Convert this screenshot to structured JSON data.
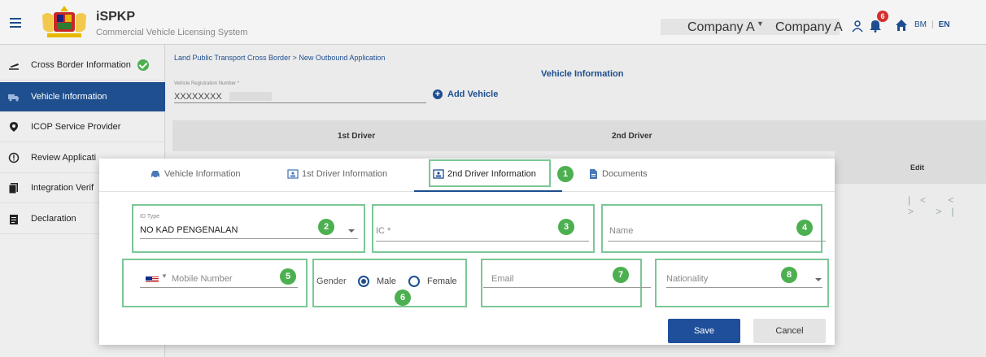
{
  "header": {
    "app_title": "iSPKP",
    "app_subtitle": "Commercial Vehicle Licensing System",
    "company_select": "Company A",
    "company_name": "Company A",
    "notification_count": "6",
    "lang_bm": "BM",
    "lang_en": "EN",
    "icons": [
      "menu-icon",
      "user-icon",
      "bell-icon",
      "home-icon"
    ]
  },
  "sidebar": {
    "items": [
      {
        "label": "Cross Border Information",
        "icon": "airplane-icon",
        "completed": true
      },
      {
        "label": "Vehicle Information",
        "icon": "truck-icon",
        "active": true
      },
      {
        "label": "ICOP Service Provider",
        "icon": "location-pin-icon"
      },
      {
        "label": "Review Applicati",
        "icon": "info-circle-icon"
      },
      {
        "label": "Integration Verif",
        "icon": "document-icon"
      },
      {
        "label": "Declaration",
        "icon": "clipboard-icon"
      }
    ]
  },
  "main": {
    "breadcrumb": "Land Public Transport Cross Border > New Outbound Application",
    "section_title": "Vehicle Information",
    "vehicle_reg_label": "Vehicle Registration Number *",
    "vehicle_reg_value": "XXXXXXXX",
    "add_vehicle": "Add Vehicle",
    "driver_1_header": "1st Driver",
    "driver_2_header": "2nd Driver",
    "edit_header": "Edit",
    "pager": "|< < > >|"
  },
  "modal": {
    "tabs": [
      {
        "label": "Vehicle Information",
        "icon": "car-icon"
      },
      {
        "label": "1st Driver Information",
        "icon": "id-card-icon"
      },
      {
        "label": "2nd Driver Information",
        "icon": "id-card-icon",
        "active": true
      },
      {
        "label": "Documents",
        "icon": "file-icon"
      }
    ],
    "id_type_label": "ID Type",
    "id_type_value": "NO KAD PENGENALAN",
    "ic_placeholder": "IC *",
    "name_placeholder": "Name",
    "mobile_placeholder": "Mobile Number",
    "gender_label": "Gender",
    "gender_options": [
      "Male",
      "Female"
    ],
    "gender_selected": "Male",
    "email_placeholder": "Email",
    "nationality_placeholder": "Nationality",
    "save": "Save",
    "cancel": "Cancel",
    "callouts": [
      "1",
      "2",
      "3",
      "4",
      "5",
      "6",
      "7",
      "8"
    ],
    "callout_color": "#4caf50",
    "accent_color": "#1f4f9a"
  }
}
